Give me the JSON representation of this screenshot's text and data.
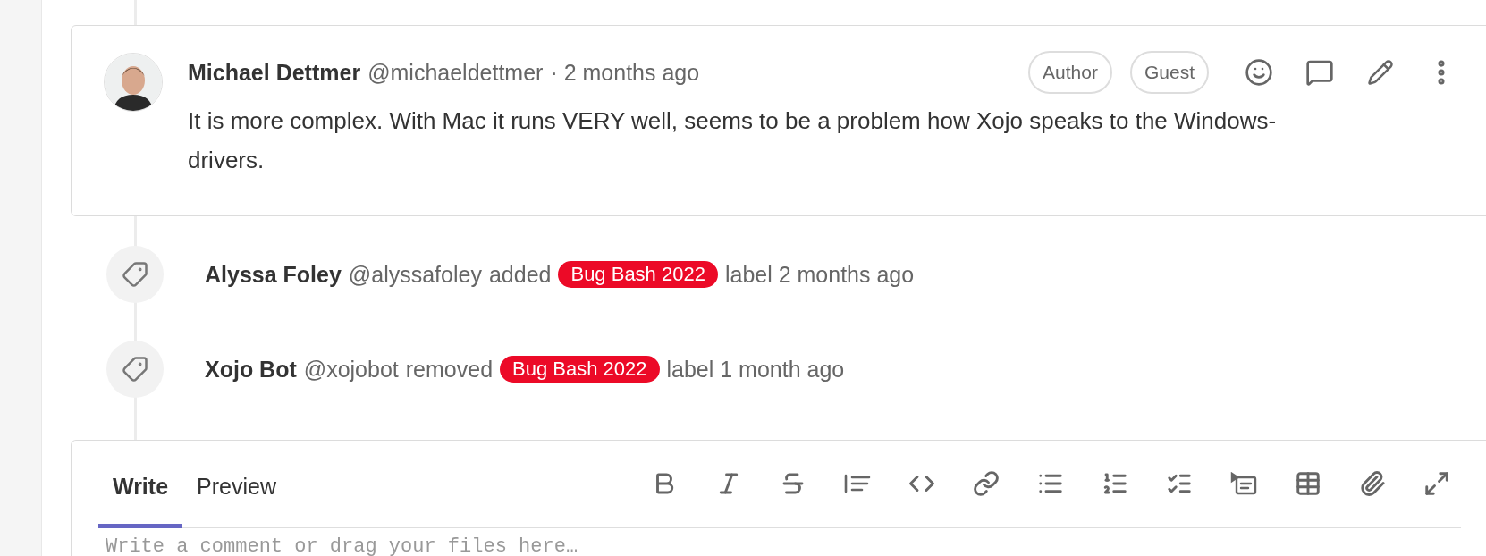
{
  "comment": {
    "author": "Michael Dettmer",
    "handle": "@michaeldettmer",
    "time": "· 2 months ago",
    "badges": [
      "Author",
      "Guest"
    ],
    "body": "It is more complex. With Mac it runs VERY well, seems to be a problem how Xojo speaks to the Windows-drivers."
  },
  "events": [
    {
      "actor": "Alyssa Foley",
      "handle": "@alyssafoley",
      "action": "added",
      "label": {
        "text": "Bug Bash 2022",
        "color": "#ec0a27"
      },
      "suffix": "label 2 months ago"
    },
    {
      "actor": "Xojo Bot",
      "handle": "@xojobot",
      "action": "removed",
      "label": {
        "text": "Bug Bash 2022",
        "color": "#ec0a27"
      },
      "suffix": "label 1 month ago"
    }
  ],
  "editor": {
    "tabs": [
      {
        "label": "Write",
        "selected": true
      },
      {
        "label": "Preview",
        "selected": false
      }
    ],
    "placeholder": "Write a comment or drag your files here…"
  }
}
